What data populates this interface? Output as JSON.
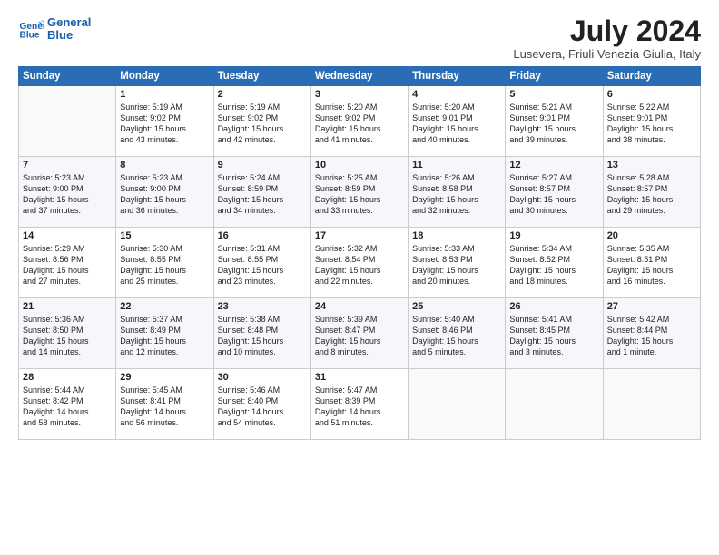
{
  "logo": {
    "line1": "General",
    "line2": "Blue"
  },
  "title": "July 2024",
  "location": "Lusevera, Friuli Venezia Giulia, Italy",
  "days_header": [
    "Sunday",
    "Monday",
    "Tuesday",
    "Wednesday",
    "Thursday",
    "Friday",
    "Saturday"
  ],
  "weeks": [
    [
      {
        "day": "",
        "content": ""
      },
      {
        "day": "1",
        "content": "Sunrise: 5:19 AM\nSunset: 9:02 PM\nDaylight: 15 hours\nand 43 minutes."
      },
      {
        "day": "2",
        "content": "Sunrise: 5:19 AM\nSunset: 9:02 PM\nDaylight: 15 hours\nand 42 minutes."
      },
      {
        "day": "3",
        "content": "Sunrise: 5:20 AM\nSunset: 9:02 PM\nDaylight: 15 hours\nand 41 minutes."
      },
      {
        "day": "4",
        "content": "Sunrise: 5:20 AM\nSunset: 9:01 PM\nDaylight: 15 hours\nand 40 minutes."
      },
      {
        "day": "5",
        "content": "Sunrise: 5:21 AM\nSunset: 9:01 PM\nDaylight: 15 hours\nand 39 minutes."
      },
      {
        "day": "6",
        "content": "Sunrise: 5:22 AM\nSunset: 9:01 PM\nDaylight: 15 hours\nand 38 minutes."
      }
    ],
    [
      {
        "day": "7",
        "content": "Sunrise: 5:23 AM\nSunset: 9:00 PM\nDaylight: 15 hours\nand 37 minutes."
      },
      {
        "day": "8",
        "content": "Sunrise: 5:23 AM\nSunset: 9:00 PM\nDaylight: 15 hours\nand 36 minutes."
      },
      {
        "day": "9",
        "content": "Sunrise: 5:24 AM\nSunset: 8:59 PM\nDaylight: 15 hours\nand 34 minutes."
      },
      {
        "day": "10",
        "content": "Sunrise: 5:25 AM\nSunset: 8:59 PM\nDaylight: 15 hours\nand 33 minutes."
      },
      {
        "day": "11",
        "content": "Sunrise: 5:26 AM\nSunset: 8:58 PM\nDaylight: 15 hours\nand 32 minutes."
      },
      {
        "day": "12",
        "content": "Sunrise: 5:27 AM\nSunset: 8:57 PM\nDaylight: 15 hours\nand 30 minutes."
      },
      {
        "day": "13",
        "content": "Sunrise: 5:28 AM\nSunset: 8:57 PM\nDaylight: 15 hours\nand 29 minutes."
      }
    ],
    [
      {
        "day": "14",
        "content": "Sunrise: 5:29 AM\nSunset: 8:56 PM\nDaylight: 15 hours\nand 27 minutes."
      },
      {
        "day": "15",
        "content": "Sunrise: 5:30 AM\nSunset: 8:55 PM\nDaylight: 15 hours\nand 25 minutes."
      },
      {
        "day": "16",
        "content": "Sunrise: 5:31 AM\nSunset: 8:55 PM\nDaylight: 15 hours\nand 23 minutes."
      },
      {
        "day": "17",
        "content": "Sunrise: 5:32 AM\nSunset: 8:54 PM\nDaylight: 15 hours\nand 22 minutes."
      },
      {
        "day": "18",
        "content": "Sunrise: 5:33 AM\nSunset: 8:53 PM\nDaylight: 15 hours\nand 20 minutes."
      },
      {
        "day": "19",
        "content": "Sunrise: 5:34 AM\nSunset: 8:52 PM\nDaylight: 15 hours\nand 18 minutes."
      },
      {
        "day": "20",
        "content": "Sunrise: 5:35 AM\nSunset: 8:51 PM\nDaylight: 15 hours\nand 16 minutes."
      }
    ],
    [
      {
        "day": "21",
        "content": "Sunrise: 5:36 AM\nSunset: 8:50 PM\nDaylight: 15 hours\nand 14 minutes."
      },
      {
        "day": "22",
        "content": "Sunrise: 5:37 AM\nSunset: 8:49 PM\nDaylight: 15 hours\nand 12 minutes."
      },
      {
        "day": "23",
        "content": "Sunrise: 5:38 AM\nSunset: 8:48 PM\nDaylight: 15 hours\nand 10 minutes."
      },
      {
        "day": "24",
        "content": "Sunrise: 5:39 AM\nSunset: 8:47 PM\nDaylight: 15 hours\nand 8 minutes."
      },
      {
        "day": "25",
        "content": "Sunrise: 5:40 AM\nSunset: 8:46 PM\nDaylight: 15 hours\nand 5 minutes."
      },
      {
        "day": "26",
        "content": "Sunrise: 5:41 AM\nSunset: 8:45 PM\nDaylight: 15 hours\nand 3 minutes."
      },
      {
        "day": "27",
        "content": "Sunrise: 5:42 AM\nSunset: 8:44 PM\nDaylight: 15 hours\nand 1 minute."
      }
    ],
    [
      {
        "day": "28",
        "content": "Sunrise: 5:44 AM\nSunset: 8:42 PM\nDaylight: 14 hours\nand 58 minutes."
      },
      {
        "day": "29",
        "content": "Sunrise: 5:45 AM\nSunset: 8:41 PM\nDaylight: 14 hours\nand 56 minutes."
      },
      {
        "day": "30",
        "content": "Sunrise: 5:46 AM\nSunset: 8:40 PM\nDaylight: 14 hours\nand 54 minutes."
      },
      {
        "day": "31",
        "content": "Sunrise: 5:47 AM\nSunset: 8:39 PM\nDaylight: 14 hours\nand 51 minutes."
      },
      {
        "day": "",
        "content": ""
      },
      {
        "day": "",
        "content": ""
      },
      {
        "day": "",
        "content": ""
      }
    ]
  ]
}
